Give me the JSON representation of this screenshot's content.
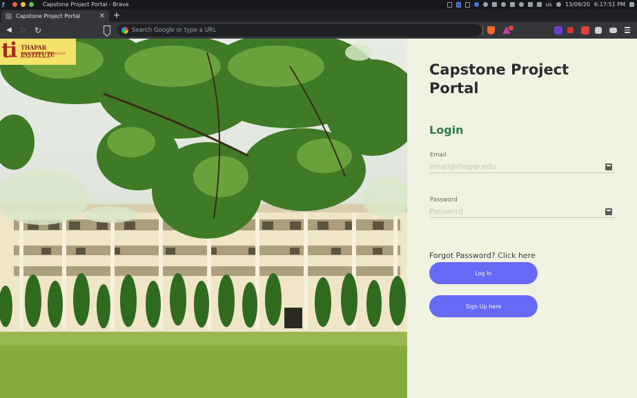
{
  "system": {
    "window_title": "Capstone Project Portal - Brave",
    "locale": "us",
    "date": "13/09/20",
    "time": "6:17:51 PM"
  },
  "browser": {
    "tab_title": "Capstone Project Portal",
    "omnibox_placeholder": "Search Google or type a URL",
    "accent_colors": {
      "shield": "#f46a2a",
      "rewards": "#c33ea8"
    }
  },
  "hero": {
    "logo_mark": "ti",
    "logo_name": "THAPAR INSTITUTE",
    "logo_sub": "OF ENGINEERING & TECHNOLOGY (Deemed to be University)"
  },
  "login": {
    "portal_title": "Capstone Project Portal",
    "heading": "Login",
    "email_label": "Email",
    "email_placeholder": "email@thapar.edu",
    "password_label": "Password",
    "password_placeholder": "Password",
    "forgot_text": "Forgot Password? Click here",
    "login_button": "Log In",
    "signup_button": "Sign Up here",
    "colors": {
      "panel": "#f0f2e2",
      "title": "#2c2c2e",
      "heading": "#2e7d4b",
      "button": "#6569f4"
    }
  }
}
